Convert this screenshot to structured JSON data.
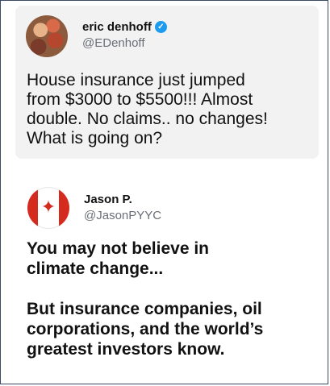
{
  "tweets": [
    {
      "name": "eric denhoff",
      "handle": "@EDenhoff",
      "verified": true,
      "text": "House insurance just jumped\nfrom $3000 to $5500!!! Almost\ndouble. No claims.. no changes!\nWhat is going on?"
    },
    {
      "name": "Jason P.",
      "handle": "@JasonPYYC",
      "text": "You may not believe in\nclimate change...\n\nBut insurance companies, oil\ncorporations, and the world’s\ngreatest investors know."
    }
  ],
  "icons": {
    "verified": "verified-badge-icon",
    "canada_flag": "canada-flag-icon"
  },
  "colors": {
    "verified": "#1d9bf0",
    "flag_red": "#d52b1e",
    "card_bg": "#f2f2f3",
    "handle_gray": "#6a6f75"
  }
}
